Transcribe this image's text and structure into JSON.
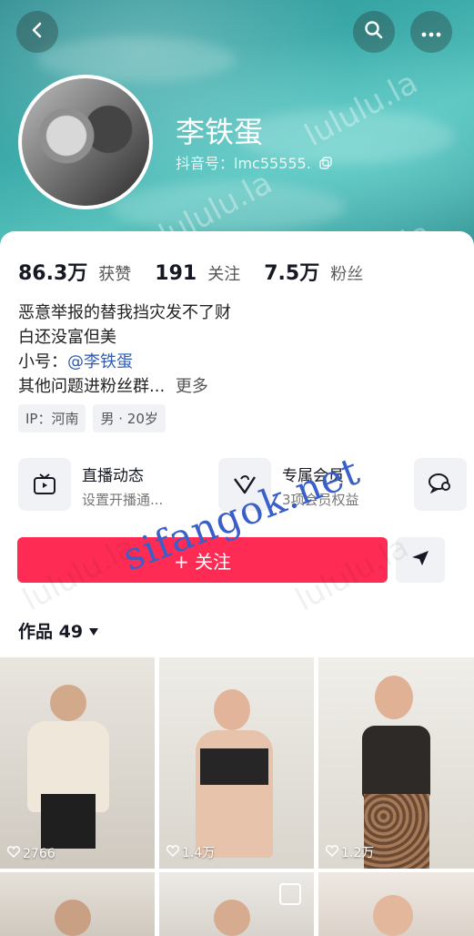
{
  "header": {
    "back_icon": "chevron-left-icon",
    "search_icon": "search-icon",
    "more_icon": "more-dots-icon"
  },
  "profile": {
    "name": "李铁蛋",
    "douyin_id": "抖音号：lmc55555."
  },
  "stats": [
    {
      "value": "86.3万",
      "label": "获赞"
    },
    {
      "value": "191",
      "label": "关注"
    },
    {
      "value": "7.5万",
      "label": "粉丝"
    }
  ],
  "bio": {
    "line1": "恶意举报的替我挡灾发不了财",
    "line2": "白还没富但美",
    "line3_prefix": "小号：",
    "line3_link": "@李铁蛋",
    "line4": "其他问题进粉丝群...",
    "more": "更多"
  },
  "tags": [
    "IP：河南",
    "男 · 20岁"
  ],
  "cards": {
    "live": {
      "title": "直播动态",
      "sub": "设置开播通..."
    },
    "member": {
      "title": "专属会员",
      "sub": "3项会员权益"
    }
  },
  "actions": {
    "follow": "+ 关注"
  },
  "works": {
    "label": "作品 49"
  },
  "videos": [
    {
      "likes": "2766"
    },
    {
      "likes": "1.4万"
    },
    {
      "likes": "1.2万"
    }
  ],
  "watermarks": [
    "lululu.la",
    "sifangok.net"
  ],
  "colors": {
    "accent": "#fe2c55",
    "link": "#2f5bb7"
  }
}
